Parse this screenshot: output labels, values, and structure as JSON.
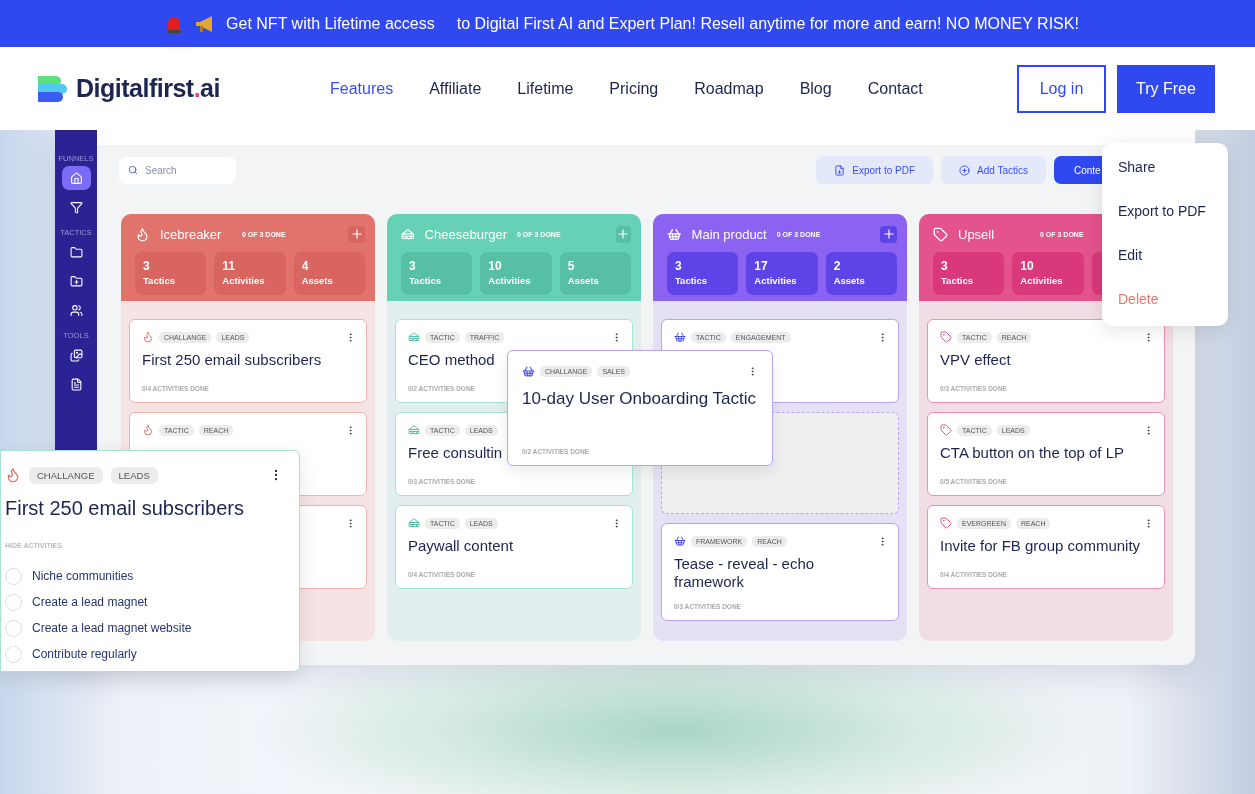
{
  "banner": {
    "parts": [
      "Get NFT with Lifetime access",
      "to Digital First AI and Expert Plan! Resell anytime for more and earn! NO MONEY RISK!"
    ]
  },
  "nav": {
    "logo": {
      "name": "Digitalfirst",
      "dot": ".",
      "suffix": "ai"
    },
    "links": [
      {
        "label": "Features",
        "selected": true
      },
      {
        "label": "Affiliate",
        "selected": false
      },
      {
        "label": "Lifetime",
        "selected": false
      },
      {
        "label": "Pricing",
        "selected": false
      },
      {
        "label": "Roadmap",
        "selected": false
      },
      {
        "label": "Blog",
        "selected": false
      },
      {
        "label": "Contact",
        "selected": false
      }
    ],
    "login": "Log in",
    "cta": "Try Free"
  },
  "app": {
    "sidebar": [
      {
        "label": "FUNNELS",
        "items": [
          {
            "selected": true
          },
          {
            "selected": false
          }
        ]
      },
      {
        "label": "TACTICS",
        "items": [
          {
            "selected": false
          },
          {
            "selected": false
          },
          {
            "selected": false
          }
        ]
      },
      {
        "label": "TOOLS",
        "items": [
          {
            "selected": false
          },
          {
            "selected": false
          }
        ]
      }
    ],
    "search": {
      "placeholder": "Search"
    },
    "toolbar": [
      {
        "kind": "export",
        "label": "Export to PDF"
      },
      {
        "kind": "add",
        "label": "Add Tactics"
      },
      {
        "kind": "primary",
        "label": "Conte"
      }
    ],
    "columns": [
      {
        "kind": "fire",
        "title": "Icebreaker",
        "progress": "0 OF 3 DONE",
        "stats": [
          {
            "value": "3",
            "label": "Tactics"
          },
          {
            "value": "11",
            "label": "Activities"
          },
          {
            "value": "4",
            "label": "Assets"
          }
        ],
        "cards": [
          {
            "kind": "card",
            "tags": [
              "CHALLANGE",
              "LEADS"
            ],
            "title": "First 250 email subscribers",
            "done": "0/4 ACTIVITIES DONE"
          },
          {
            "kind": "card",
            "tags": [
              "TACTIC",
              "REACH"
            ]
          },
          {
            "kind": "card"
          }
        ]
      },
      {
        "kind": "burger",
        "title": "Cheeseburger",
        "progress": "0 OF 3 DONE",
        "stats": [
          {
            "value": "3",
            "label": "Tactics"
          },
          {
            "value": "10",
            "label": "Activities"
          },
          {
            "value": "5",
            "label": "Assets"
          }
        ],
        "cards": [
          {
            "kind": "card",
            "tags": [
              "TACTIC",
              "TRAFFIC"
            ],
            "title": "CEO method",
            "done": "0/2 ACTIVITIES DONE"
          },
          {
            "kind": "card",
            "tags": [
              "TACTIC",
              "LEADS"
            ],
            "title": "Free consultin",
            "done": "0/3 ACTIVITIES DONE"
          },
          {
            "kind": "card",
            "tags": [
              "TACTIC",
              "LEADS"
            ],
            "title": "Paywall content",
            "done": "0/4 ACTIVITIES DONE"
          }
        ]
      },
      {
        "kind": "basket",
        "title": "Main product",
        "progress": "0 OF 3 DONE",
        "stats": [
          {
            "value": "3",
            "label": "Tactics"
          },
          {
            "value": "17",
            "label": "Activities"
          },
          {
            "value": "2",
            "label": "Assets"
          }
        ],
        "cards": [
          {
            "kind": "card",
            "tags": [
              "TACTIC",
              "ENGAGEMENT"
            ]
          },
          {
            "kind": "placeholder"
          },
          {
            "kind": "card",
            "tags": [
              "FRAMEWORK",
              "REACH"
            ],
            "title": "Tease - reveal - echo framework",
            "done": "0/3 ACTIVITIES DONE"
          }
        ]
      },
      {
        "kind": "tag",
        "title": "Upsell",
        "progress": "0 OF 3 DONE",
        "stats": [
          {
            "value": "3",
            "label": "Tactics"
          },
          {
            "value": "10",
            "label": "Activities"
          }
        ],
        "cards": [
          {
            "kind": "card",
            "tags": [
              "TACTIC",
              "REACH"
            ],
            "title": "VPV effect",
            "done": "0/3 ACTIVITIES DONE"
          },
          {
            "kind": "card",
            "tags": [
              "TACTIC",
              "LEADS"
            ],
            "title": "CTA button on the top of LP",
            "done": "0/5 ACTIVITIES DONE"
          },
          {
            "kind": "card",
            "tags": [
              "EVERGREEN",
              "REACH"
            ],
            "title": "Invite for FB group community",
            "done": "0/4 ACTIVITIES DONE"
          }
        ]
      }
    ]
  },
  "dragged_card": {
    "kind": "basket",
    "tags": [
      "CHALLANGE",
      "SALES"
    ],
    "title": "10-day User Onboarding Tactic",
    "done": "0/2 ACTIVITIES DONE"
  },
  "expanded_card": {
    "kind": "fire",
    "tags": [
      "CHALLANGE",
      "LEADS"
    ],
    "title": "First 250 email subscribers",
    "toggle": "HIDE ACTIVITIES",
    "activities": [
      {
        "label": "Niche communities",
        "checked": false
      },
      {
        "label": "Create a lead magnet",
        "checked": false
      },
      {
        "label": "Create a lead magnet website",
        "checked": false
      },
      {
        "label": "Contribute regularly",
        "checked": false
      }
    ]
  },
  "menu": [
    {
      "kind": "normal",
      "label": "Share"
    },
    {
      "kind": "normal",
      "label": "Export to PDF"
    },
    {
      "kind": "normal",
      "label": "Edit"
    },
    {
      "kind": "danger",
      "label": "Delete"
    }
  ]
}
